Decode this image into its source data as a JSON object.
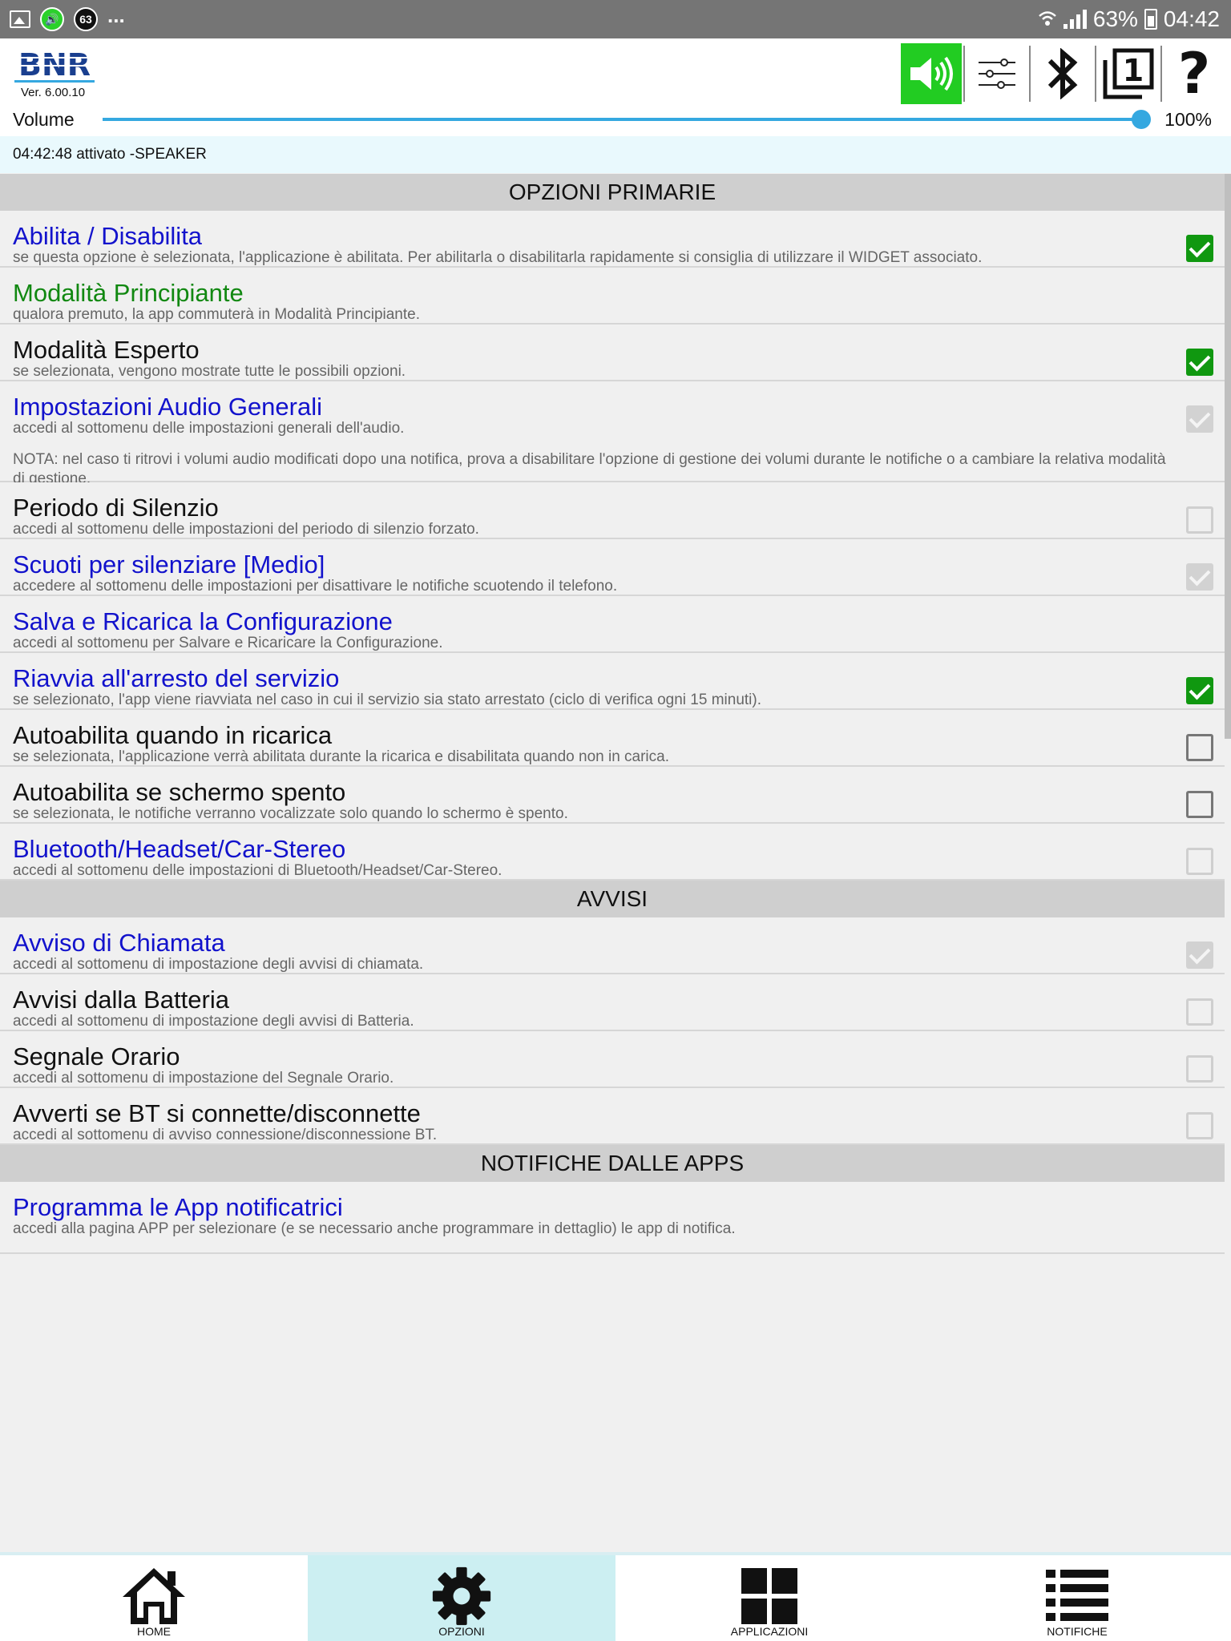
{
  "statusbar": {
    "notif_badge": "63",
    "overflow": "...",
    "battery": "63%",
    "time": "04:42"
  },
  "header": {
    "logo_text": "BNR",
    "version": "Ver. 6.00.10"
  },
  "volume": {
    "label": "Volume",
    "value_text": "100%",
    "level": 1.0
  },
  "status_message": "04:42:48 attivato -SPEAKER",
  "sections": {
    "primary": "OPZIONI PRIMARIE",
    "alerts": "AVVISI",
    "apps": "NOTIFICHE DALLE APPS"
  },
  "items": [
    {
      "title": "Abilita / Disabilita",
      "desc": "se questa opzione è selezionata, l'applicazione è abilitata. Per abilitarla o disabilitarla rapidamente si consiglia di utilizzare il WIDGET associato.",
      "state": "checked",
      "color": "#1212cc"
    },
    {
      "title": "Modalità Principiante",
      "desc": "qualora premuto, la app commuterà in Modalità Principiante.",
      "state": "none",
      "color": "#118811"
    },
    {
      "title": "Modalità Esperto",
      "desc": "se selezionata, vengono mostrate tutte le possibili opzioni.",
      "state": "checked",
      "color": "#111111"
    },
    {
      "title": "Impostazioni Audio Generali",
      "desc": "accedi al sottomenu delle impostazioni generali dell'audio.",
      "note": "NOTA: nel caso ti ritrovi i volumi audio modificati dopo una notifica, prova a disabilitare l'opzione di gestione dei volumi durante le notifiche o a cambiare la relativa modalità di gestione.",
      "state": "disabled-checked",
      "color": "#1212cc"
    },
    {
      "title": "Periodo di Silenzio",
      "desc": "accedi al sottomenu delle impostazioni del periodo di silenzio forzato.",
      "state": "disabled-unchecked",
      "color": "#111111"
    },
    {
      "title": "Scuoti per silenziare  [Medio]",
      "desc": "accedere al sottomenu delle impostazioni per disattivare le notifiche scuotendo il telefono.",
      "state": "disabled-checked",
      "color": "#1212cc"
    },
    {
      "title": "Salva e Ricarica la Configurazione",
      "desc": "accedi al sottomenu per Salvare e Ricaricare la Configurazione.",
      "state": "none",
      "color": "#1212cc"
    },
    {
      "title": "Riavvia all'arresto del servizio",
      "desc": "se selezionato, l'app viene riavviata nel caso in cui il servizio sia stato arrestato (ciclo di verifica ogni 15 minuti).",
      "state": "checked",
      "color": "#1212cc"
    },
    {
      "title": "Autoabilita quando in ricarica",
      "desc": "se selezionata, l'applicazione verrà abilitata durante la ricarica e disabilitata quando non in carica.",
      "state": "unchecked",
      "color": "#111111"
    },
    {
      "title": "Autoabilita se schermo spento",
      "desc": "se selezionata, le notifiche verranno vocalizzate solo quando lo schermo è spento.",
      "state": "unchecked",
      "color": "#111111"
    },
    {
      "title": "Bluetooth/Headset/Car-Stereo",
      "desc": "accedi al sottomenu delle impostazioni di Bluetooth/Headset/Car-Stereo.",
      "state": "disabled-unchecked",
      "color": "#1212cc"
    },
    {
      "title": "Avviso di Chiamata",
      "desc": "accedi al sottomenu di impostazione degli avvisi di chiamata.",
      "state": "disabled-checked",
      "color": "#1212cc"
    },
    {
      "title": "Avvisi dalla Batteria",
      "desc": "accedi al sottomenu di impostazione degli avvisi di Batteria.",
      "state": "disabled-unchecked",
      "color": "#111111"
    },
    {
      "title": "Segnale Orario",
      "desc": "accedi al sottomenu di impostazione del Segnale Orario.",
      "state": "disabled-unchecked",
      "color": "#111111"
    },
    {
      "title": "Avverti se BT si connette/disconnette",
      "desc": "accedi al sottomenu di avviso connessione/disconnessione BT.",
      "state": "disabled-unchecked",
      "color": "#111111"
    },
    {
      "title": "Programma le App notificatrici",
      "desc": "accedi alla pagina APP per selezionare (e se necessario anche programmare in dettaglio) le app di notifica.",
      "state": "none",
      "color": "#1212cc"
    }
  ],
  "nav": {
    "home": "HOME",
    "options": "OPZIONI",
    "apps": "APPLICAZIONI",
    "notifications": "NOTIFICHE"
  },
  "colors": {
    "accent_green": "#22cc22",
    "checkbox_green": "#109810",
    "link_blue": "#1212cc",
    "slider_blue": "#35a8e0",
    "active_tab": "#cceff2"
  }
}
